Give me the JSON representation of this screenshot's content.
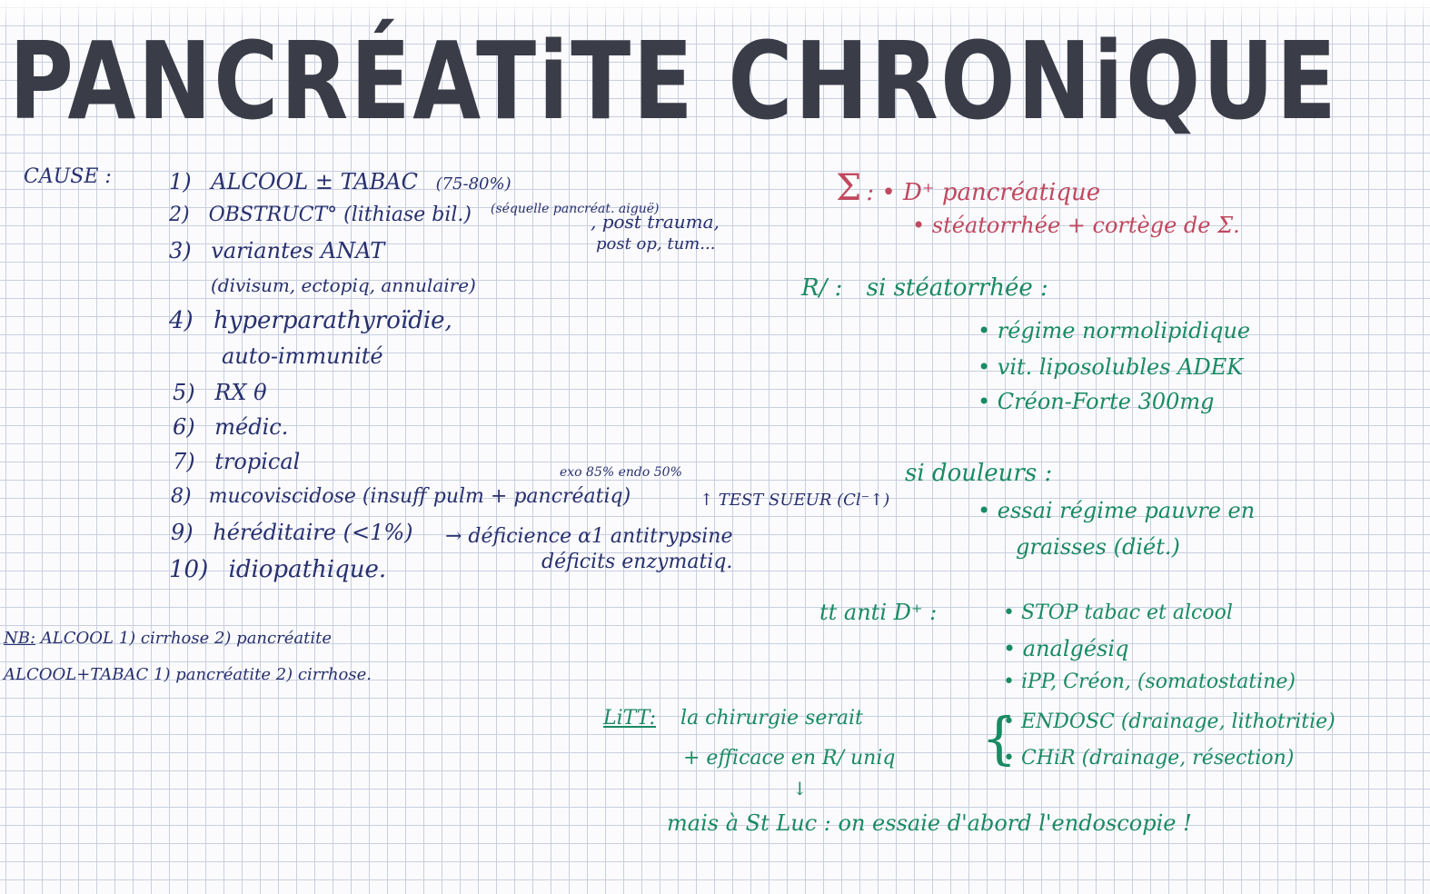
{
  "title": "PANCRÉATiTE CHRONiQUE",
  "causes": {
    "label": "CAUSE :",
    "items": [
      {
        "num": "1)",
        "text": "ALCOOL ± TABAC",
        "note": "(75-80%)"
      },
      {
        "num": "2)",
        "text": "OBSTRUCT° (lithiase bil.)",
        "note": "(séquelle pancréat. aiguë)",
        "extra": ", post trauma,",
        "extra2": "post op, tum..."
      },
      {
        "num": "3)",
        "text": "variantes ANAT",
        "line2": "(divisum, ectopiq, annulaire)"
      },
      {
        "num": "4)",
        "text": "hyperparathyroïdie,",
        "line2": "auto-immunité"
      },
      {
        "num": "5)",
        "text": "RX θ"
      },
      {
        "num": "6)",
        "text": "médic."
      },
      {
        "num": "7)",
        "text": "tropical"
      },
      {
        "num": "8)",
        "text": "mucoviscidose (insuff pulm + pancréatiq)",
        "extra": "↑ TEST SUEUR (Cl⁻↑)",
        "note_above": "exo 85%  endo 50%"
      },
      {
        "num": "9)",
        "text": "héréditaire (<1%)",
        "extra": "→ déficience α1 antitrypsine",
        "extra2": "déficits enzymatiq."
      },
      {
        "num": "10)",
        "text": "idiopathique."
      }
    ]
  },
  "nb": {
    "label": "NB:",
    "line1": "ALCOOL 1) cirrhose 2) pancréatite",
    "line2": "ALCOOL+TABAC 1) pancréatite 2) cirrhose."
  },
  "symptoms": {
    "sigma": "Σ",
    "line1": ": • D⁺ pancréatique",
    "line2": "• stéatorrhée + cortège de Σ."
  },
  "treatment": {
    "label": "R/ :",
    "cond1": "si stéatorrhée :",
    "items1": [
      "• régime normolipidique",
      "• vit. liposolubles ADEK",
      "• Créon-Forte 300mg"
    ],
    "cond2": "si douleurs :",
    "items2_line1": "• essai régime pauvre en",
    "items2_line2": "graisses (diét.)",
    "anti_label": "tt anti D⁺ :",
    "anti_items": [
      "• STOP tabac et alcool",
      "• analgésiq",
      "• iPP, Créon, (somatostatine)",
      "• ENDOSC (drainage, lithotritie)",
      "• CHiR (drainage, résection)"
    ],
    "litt_label": "LiTT:",
    "litt_line1": "la chirurgie serait",
    "litt_line2": "+ efficace en R/ uniq",
    "arrow": "↓",
    "stluc": "mais à St Luc : on essaie d'abord l'endoscopie !"
  }
}
